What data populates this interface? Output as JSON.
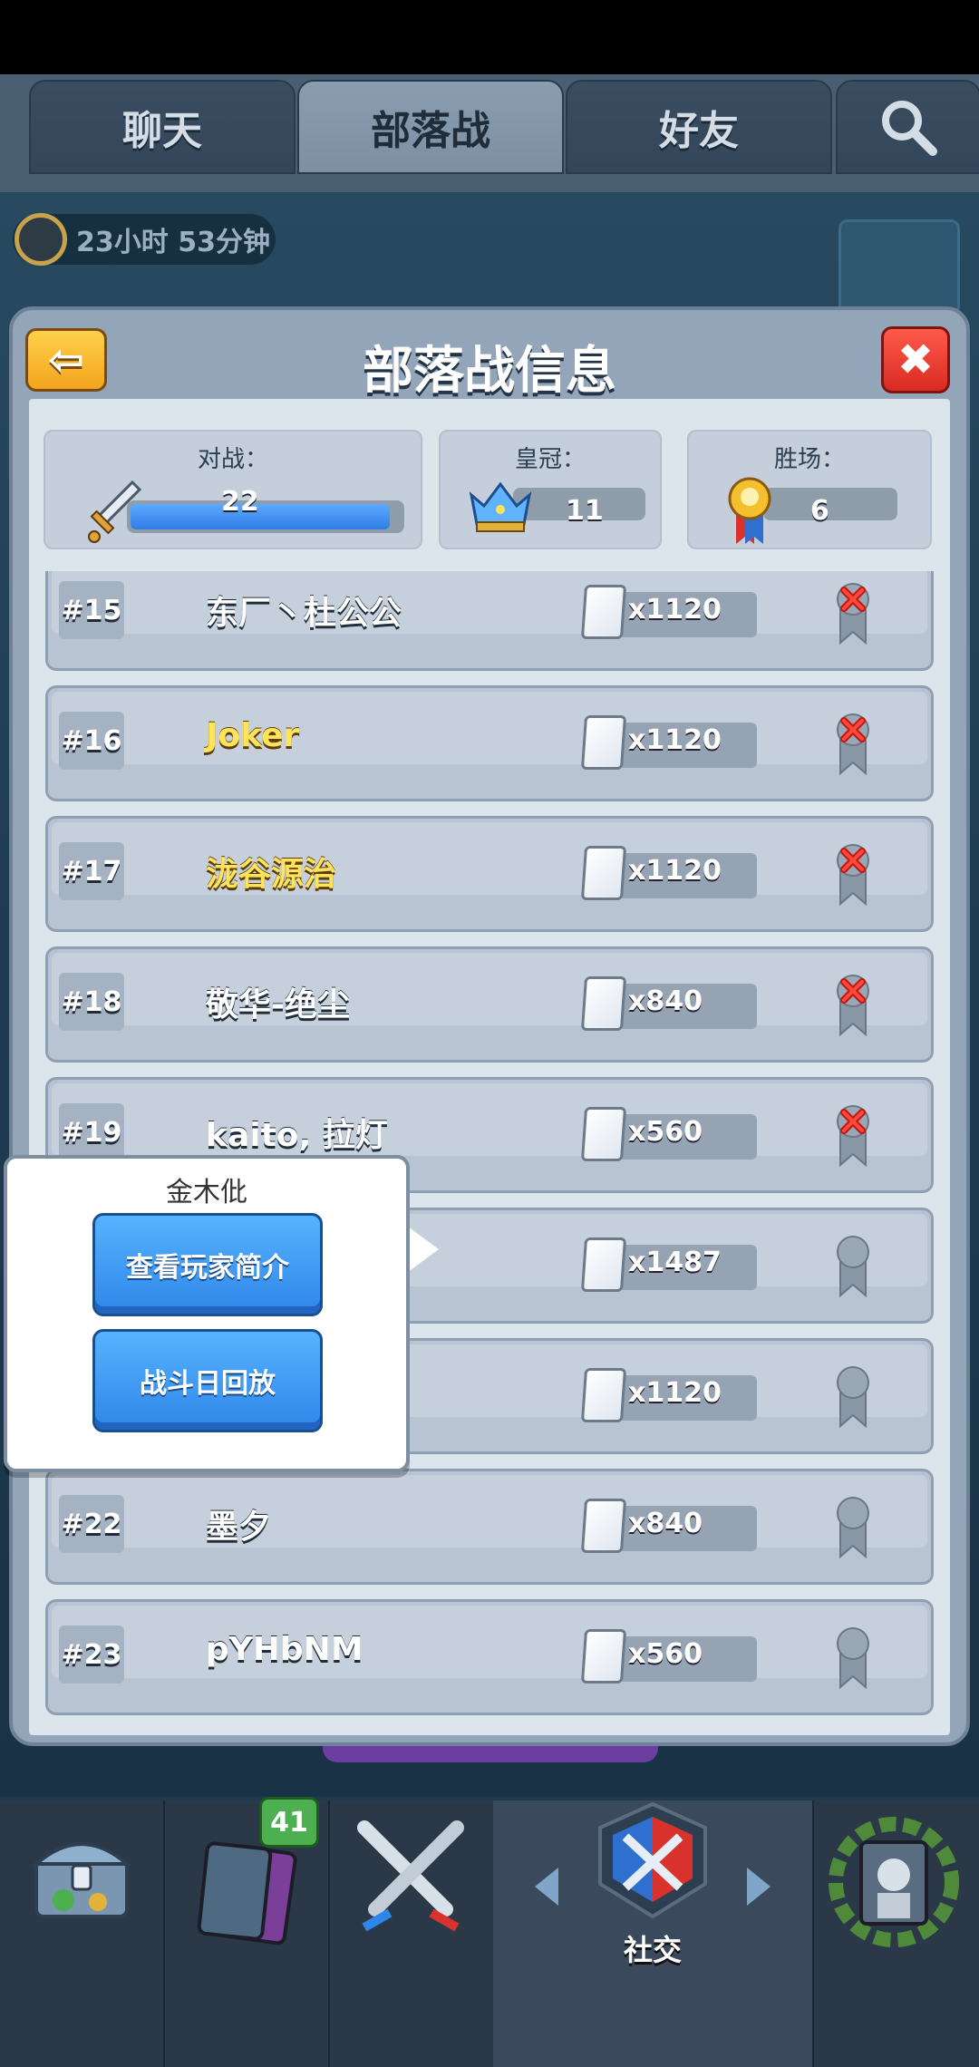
{
  "tabs": [
    {
      "label": "聊天",
      "active": false
    },
    {
      "label": "部落战",
      "active": true
    },
    {
      "label": "好友",
      "active": false
    }
  ],
  "timer": {
    "text": "23小时 53分钟"
  },
  "dialog": {
    "title": "部落战信息",
    "back_icon": "arrow-left-icon",
    "close_icon": "close-x-icon"
  },
  "stats": {
    "battles": {
      "label": "对战：",
      "value": "22",
      "progress": 0.96
    },
    "crowns": {
      "label": "皇冠：",
      "value": "11"
    },
    "wins": {
      "label": "胜场：",
      "value": "6"
    }
  },
  "members": [
    {
      "rank": "#15",
      "name": "东厂丶杜公公",
      "cards": "x1120",
      "gold": false,
      "status": "lost"
    },
    {
      "rank": "#16",
      "name": "Joker",
      "cards": "x1120",
      "gold": true,
      "status": "lost"
    },
    {
      "rank": "#17",
      "name": "泷谷源治",
      "cards": "x1120",
      "gold": true,
      "status": "lost"
    },
    {
      "rank": "#18",
      "name": "敬华-绝尘",
      "cards": "x840",
      "gold": false,
      "status": "lost"
    },
    {
      "rank": "#19",
      "name": "kaito, 拉灯",
      "cards": "x560",
      "gold": false,
      "status": "lost"
    },
    {
      "rank": "",
      "name": "",
      "cards": "x1487",
      "gold": false,
      "status": "none"
    },
    {
      "rank": "",
      "name": "",
      "cards": "x1120",
      "gold": false,
      "status": "none"
    },
    {
      "rank": "#22",
      "name": "墨夕",
      "cards": "x840",
      "gold": false,
      "status": "none"
    },
    {
      "rank": "#23",
      "name": "pYHbNM",
      "cards": "x560",
      "gold": false,
      "status": "none"
    }
  ],
  "popup": {
    "player_name": "金木仳",
    "view_profile_label": "查看玩家简介",
    "replay_label": "战斗日回放"
  },
  "bottom_nav": {
    "cards_badge": "41",
    "social_label": "社交"
  },
  "colors": {
    "accent_blue": "#2f86e8",
    "gold_name": "#ffe35a",
    "close_red": "#d92a22",
    "back_yellow": "#f2a51c",
    "badge_green": "#4caf50"
  }
}
